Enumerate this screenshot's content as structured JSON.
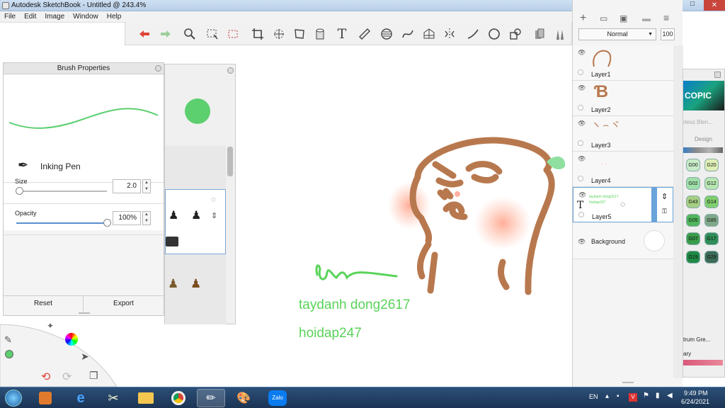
{
  "window": {
    "title": "Autodesk SketchBook - Untitled @ 243.4%",
    "controls": {
      "minimize": "–",
      "maximize": "□",
      "close": "✕"
    }
  },
  "menu": [
    "File",
    "Edit",
    "Image",
    "Window",
    "Help"
  ],
  "toolbar": {
    "tools": [
      "undo-icon",
      "redo-icon",
      "zoom-icon",
      "select-icon",
      "lasso-icon",
      "crop-icon",
      "transform-icon",
      "distort-icon",
      "fill-icon",
      "text-icon",
      "ruler-icon",
      "ellipse-guide-icon",
      "french-curve-icon",
      "perspective-icon",
      "symmetry-icon",
      "line-icon",
      "circle-icon",
      "shapes-icon",
      "copic-icon",
      "brush-set-icon"
    ]
  },
  "brush_properties": {
    "title": "Brush Properties",
    "brush_name": "Inking Pen",
    "preview_color": "#5ccf6f",
    "size_label": "Size",
    "size_value": "2.0",
    "size_fraction": 0.03,
    "opacity_label": "Opacity",
    "opacity_value": "100%",
    "opacity_fraction": 1.0,
    "reset_label": "Reset",
    "export_label": "Export"
  },
  "layers": {
    "blend_mode": "Normal",
    "opacity": "100",
    "items": [
      {
        "name": "Layer1"
      },
      {
        "name": "Layer2"
      },
      {
        "name": "Layer3"
      },
      {
        "name": "Layer4"
      },
      {
        "name": "Layer5",
        "selected": true,
        "mini_text_1": "taydanh dong2617",
        "mini_text_2": "hoidap247"
      },
      {
        "name": "Background"
      }
    ]
  },
  "canvas": {
    "signature": "Unnr",
    "text_line_1": "taydanh dong2617",
    "text_line_2": "hoidap247",
    "text_color": "#5ad35a",
    "drawing_color": "#b8784e"
  },
  "copic": {
    "logo": "COPIC",
    "blender_label": "rless Blen...",
    "design_label": "Design",
    "spectrum_label": "trum Gre...",
    "library_label": "ary",
    "swatches": [
      {
        "code": "G00",
        "color": "#c8ecc8"
      },
      {
        "code": "G20",
        "color": "#dff0b6"
      },
      {
        "code": "G02",
        "color": "#9fe0a8"
      },
      {
        "code": "G12",
        "color": "#b8e6b0"
      },
      {
        "code": "G43",
        "color": "#a6cf83"
      },
      {
        "code": "G14",
        "color": "#7fcf6e"
      },
      {
        "code": "G05",
        "color": "#4fb65c"
      },
      {
        "code": "G85",
        "color": "#7fa98a"
      },
      {
        "code": "G07",
        "color": "#3a9d4b"
      },
      {
        "code": "G17",
        "color": "#2f8e59"
      },
      {
        "code": "G19",
        "color": "#1f8a45"
      },
      {
        "code": "G29",
        "color": "#3c6c57"
      }
    ]
  },
  "taskbar": {
    "apps": [
      "start-orb-icon",
      "media-player-icon",
      "internet-explorer-icon",
      "snipping-tool-icon",
      "file-explorer-icon",
      "chrome-icon",
      "sketchbook-icon",
      "paint-icon",
      "zalo-icon"
    ],
    "zalo_label": "Zalo",
    "language": "EN",
    "time": "9:49 PM",
    "date": "6/24/2021"
  }
}
